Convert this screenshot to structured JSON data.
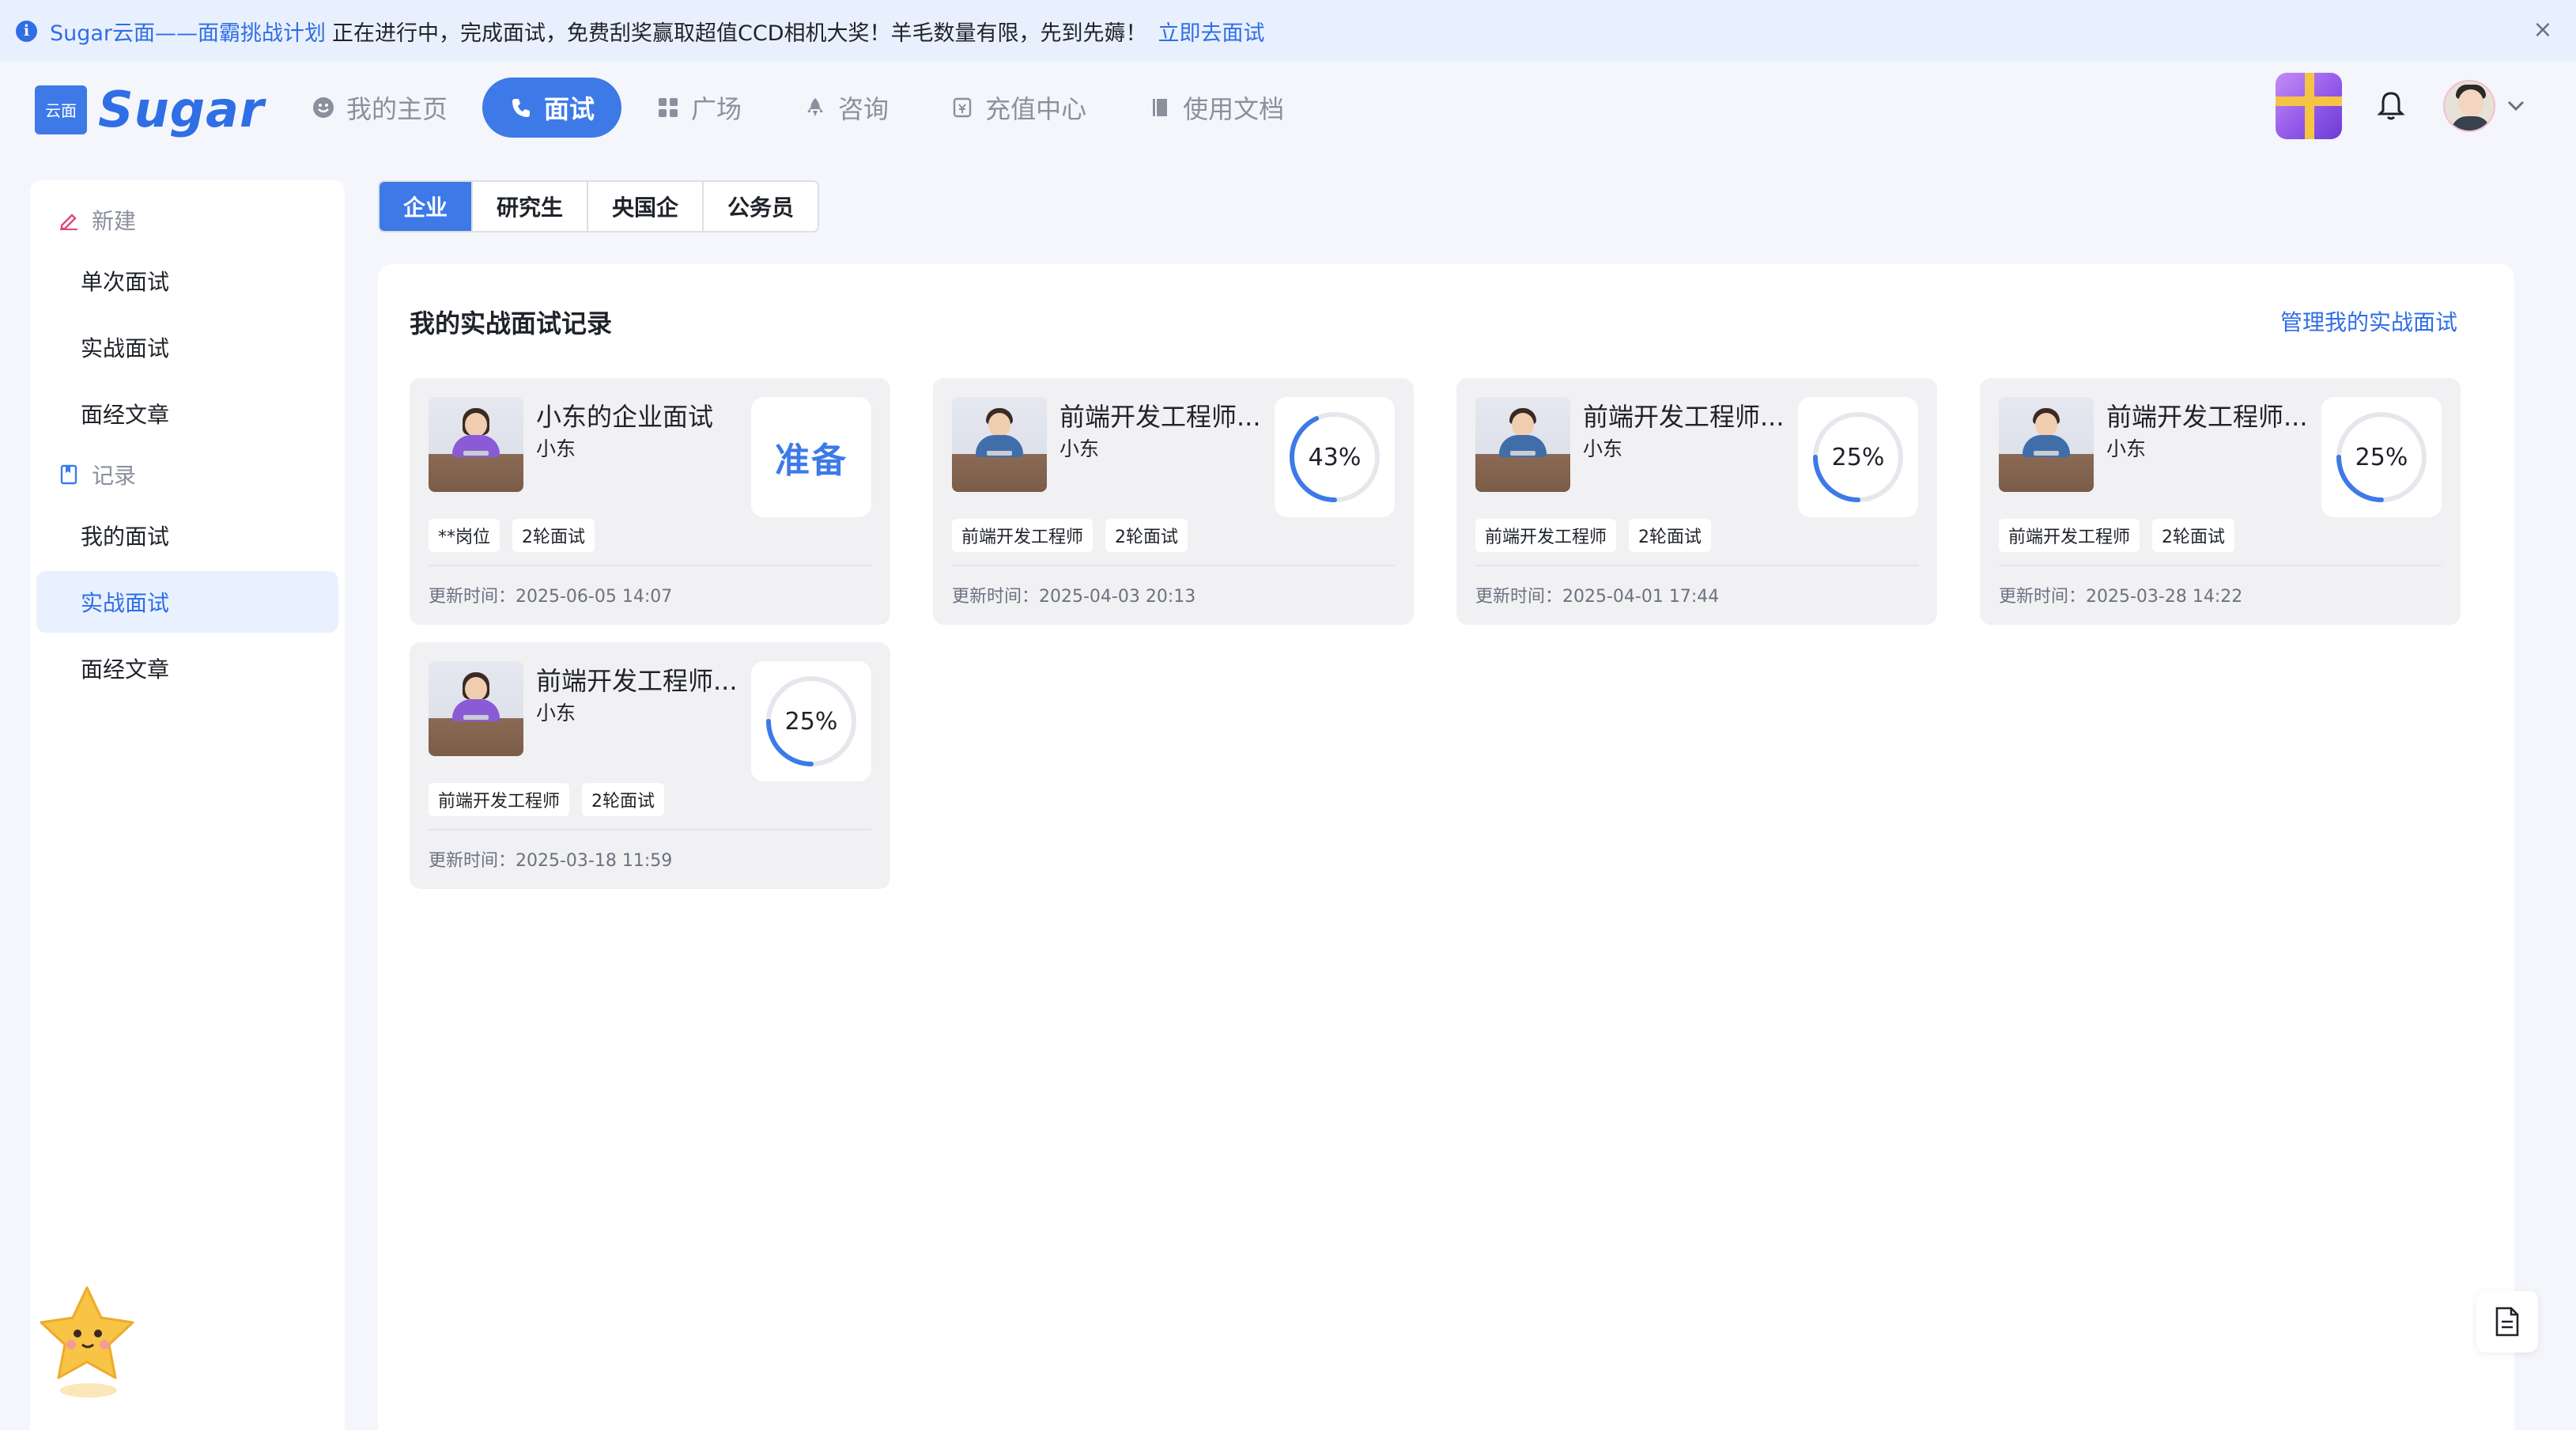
{
  "notice": {
    "highlight": "Sugar云面——面霸挑战计划",
    "text": "正在进行中，完成面试，免费刮奖赢取超值CCD相机大奖！羊毛数量有限，先到先薅！",
    "link": "立即去面试",
    "close_icon": "×"
  },
  "logo": {
    "box_text": "云面",
    "text": "Sugar"
  },
  "nav": [
    {
      "label": "我的主页",
      "icon": "smile-icon"
    },
    {
      "label": "面试",
      "icon": "phone-icon",
      "active": true
    },
    {
      "label": "广场",
      "icon": "grid-icon"
    },
    {
      "label": "咨询",
      "icon": "rocket-icon"
    },
    {
      "label": "充值中心",
      "icon": "wallet-icon"
    },
    {
      "label": "使用文档",
      "icon": "book-icon"
    }
  ],
  "sidebar": {
    "new_group": "新建",
    "new_items": [
      "单次面试",
      "实战面试",
      "面经文章"
    ],
    "record_group": "记录",
    "record_items": [
      "我的面试",
      "实战面试",
      "面经文章"
    ],
    "active_item": "实战面试"
  },
  "category_tabs": [
    "企业",
    "研究生",
    "央国企",
    "公务员"
  ],
  "active_category": "企业",
  "section": {
    "title": "我的实战面试记录",
    "manage_link": "管理我的实战面试"
  },
  "cards": [
    {
      "title": "小东的企业面试",
      "sub": "小东",
      "status": "准备",
      "avatar": "female",
      "tags": [
        "**岗位",
        "2轮面试"
      ],
      "time": "更新时间：2025-06-05 14:07"
    },
    {
      "title": "前端开发工程师...",
      "sub": "小东",
      "progress": 43,
      "progress_label": "43%",
      "avatar": "male",
      "tags": [
        "前端开发工程师",
        "2轮面试"
      ],
      "time": "更新时间：2025-04-03 20:13"
    },
    {
      "title": "前端开发工程师...",
      "sub": "小东",
      "progress": 25,
      "progress_label": "25%",
      "avatar": "male",
      "tags": [
        "前端开发工程师",
        "2轮面试"
      ],
      "time": "更新时间：2025-04-01 17:44"
    },
    {
      "title": "前端开发工程师...",
      "sub": "小东",
      "progress": 25,
      "progress_label": "25%",
      "avatar": "male",
      "tags": [
        "前端开发工程师",
        "2轮面试"
      ],
      "time": "更新时间：2025-03-28 14:22"
    },
    {
      "title": "前端开发工程师...",
      "sub": "小东",
      "progress": 25,
      "progress_label": "25%",
      "avatar": "female",
      "tags": [
        "前端开发工程师",
        "2轮面试"
      ],
      "time": "更新时间：2025-03-18 11:59"
    }
  ],
  "colors": {
    "primary": "#3d7ae8",
    "link": "#2f6ee5",
    "ring_track": "#e5e7ec"
  }
}
